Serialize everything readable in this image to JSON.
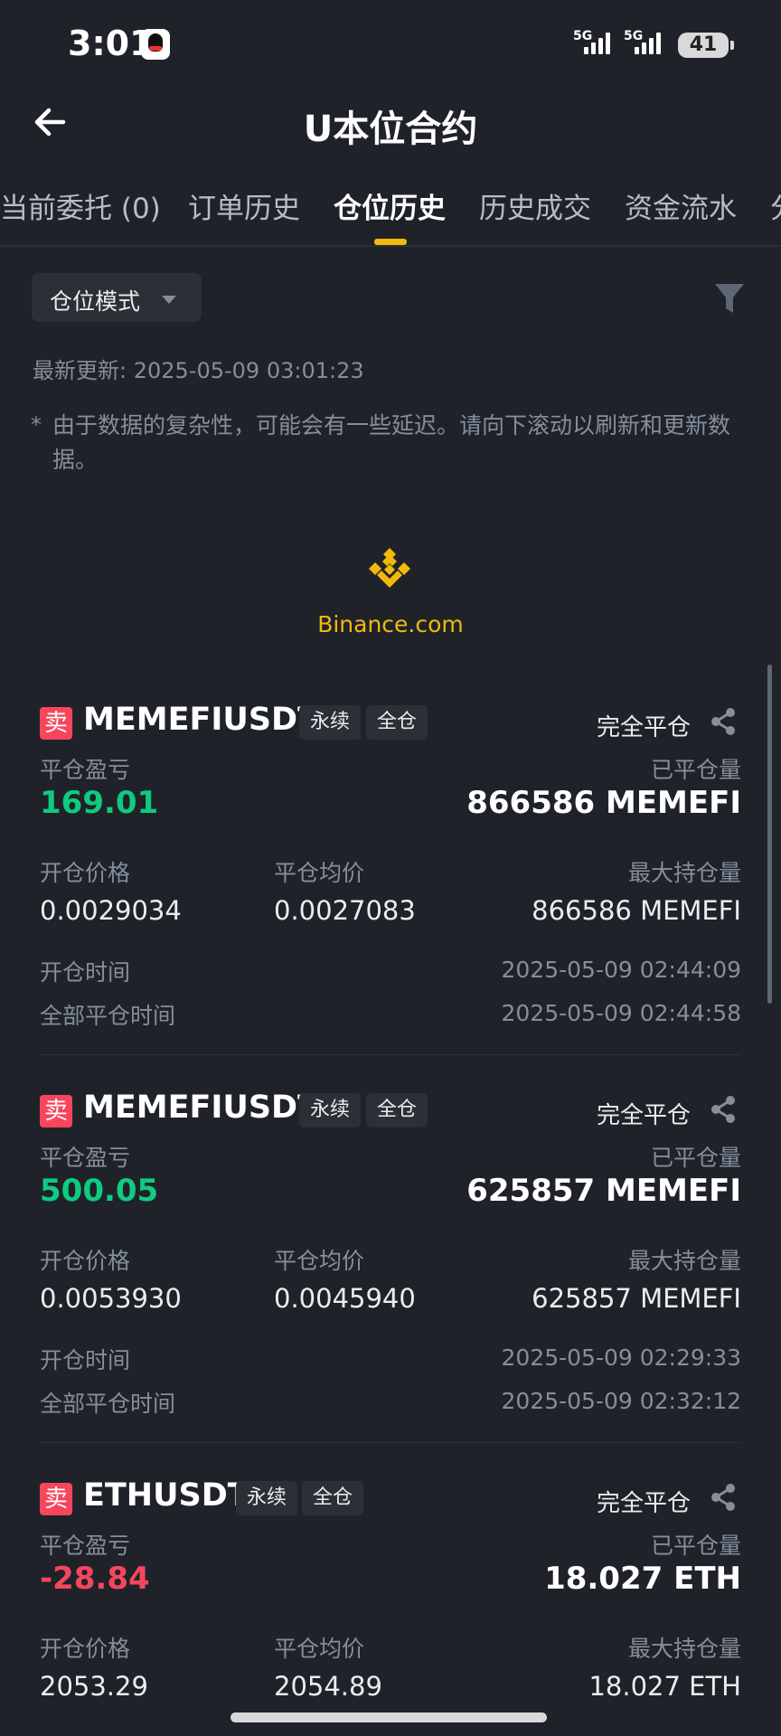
{
  "status_bar": {
    "time": "3:01",
    "network1": "5G",
    "network2": "5G",
    "battery": "41",
    "qq_icon": "qq-penguin-icon"
  },
  "header": {
    "back_icon": "arrow-left-icon",
    "title": "U本位合约"
  },
  "tabs": [
    {
      "label": "当前委托 (0)",
      "active": false
    },
    {
      "label": "订单历史",
      "active": false
    },
    {
      "label": "仓位历史",
      "active": true
    },
    {
      "label": "历史成交",
      "active": false
    },
    {
      "label": "资金流水",
      "active": false
    },
    {
      "label": "分",
      "active": false
    }
  ],
  "mode_dropdown": {
    "label": "仓位模式"
  },
  "filter_icon": "filter-icon",
  "updated_text": "最新更新: 2025-05-09 03:01:23",
  "note_star": "*",
  "note": "由于数据的复杂性，可能会有一些延迟。请向下滚动以刷新和更新数据。",
  "watermark": {
    "text": "Binance.com",
    "color": "#f0b90b"
  },
  "labels": {
    "close_pnl": "平仓盈亏",
    "closed_volume": "已平仓量",
    "entry_price": "开仓价格",
    "avg_close_price": "平仓均价",
    "max_position": "最大持仓量",
    "open_time": "开仓时间",
    "close_time": "全部平仓时间"
  },
  "positions": [
    {
      "side": "卖",
      "symbol": "MEMEFIUSDT",
      "tag1": "永续",
      "tag2": "全仓",
      "status": "完全平仓",
      "pnl": "169.01",
      "closed_volume": "866586 MEMEFI",
      "entry_price": "0.0029034",
      "avg_close_price": "0.0027083",
      "max_position": "866586 MEMEFI",
      "open_time": "2025-05-09 02:44:09",
      "close_time": "2025-05-09 02:44:58"
    },
    {
      "side": "卖",
      "symbol": "MEMEFIUSDT",
      "tag1": "永续",
      "tag2": "全仓",
      "status": "完全平仓",
      "pnl": "500.05",
      "closed_volume": "625857 MEMEFI",
      "entry_price": "0.0053930",
      "avg_close_price": "0.0045940",
      "max_position": "625857 MEMEFI",
      "open_time": "2025-05-09 02:29:33",
      "close_time": "2025-05-09 02:32:12"
    },
    {
      "side": "卖",
      "symbol": "ETHUSDT",
      "tag1": "永续",
      "tag2": "全仓",
      "status": "完全平仓",
      "pnl": "-28.84",
      "closed_volume": "18.027 ETH",
      "entry_price": "2053.29",
      "avg_close_price": "2054.89",
      "max_position": "18.027 ETH"
    }
  ],
  "colors": {
    "background": "#1f2229",
    "accent": "#f0b90b",
    "profit": "#0ecb81",
    "loss": "#f6465d"
  }
}
